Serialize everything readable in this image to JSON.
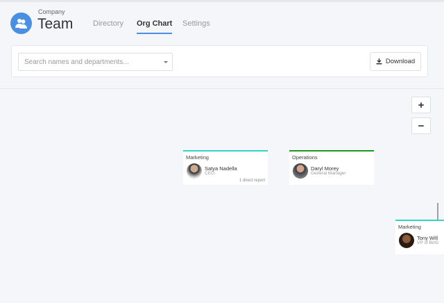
{
  "header": {
    "company": "Company",
    "title": "Team",
    "logo_icon": "users-icon",
    "accent": "#4a90e2"
  },
  "tabs": [
    {
      "label": "Directory"
    },
    {
      "label": "Org Chart",
      "active": true
    },
    {
      "label": "Settings"
    }
  ],
  "search": {
    "placeholder": "Search names and departments..."
  },
  "download": {
    "label": "Download",
    "icon": "download-icon"
  },
  "zoom": {
    "in": "+",
    "out": "−"
  },
  "cards": [
    {
      "department": "Marketing",
      "name": "Satya Nadella",
      "title": "CEO",
      "reports": "1 direct report",
      "color": "#2fd6c3"
    },
    {
      "department": "Operations",
      "name": "Daryl Morey",
      "title": "General Manager",
      "color": "#1a9c1a"
    },
    {
      "department": "Marketing",
      "name": "Tony Will",
      "title": "VP of BizD",
      "color": "#2fd6c3"
    }
  ]
}
